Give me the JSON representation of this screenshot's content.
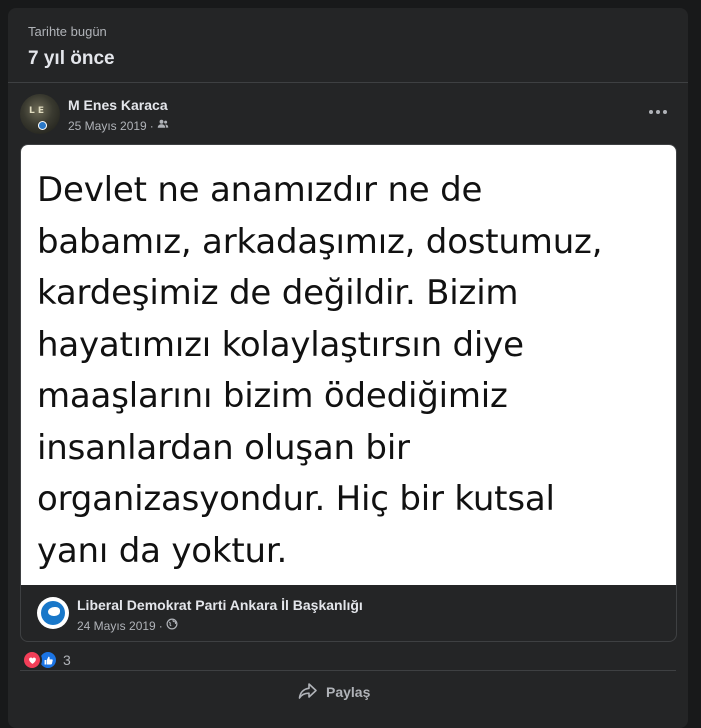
{
  "memory": {
    "subtitle": "Tarihte bugün",
    "title": "7 yıl önce"
  },
  "post": {
    "author": "M Enes Karaca",
    "date": "25 Mayıs 2019",
    "separator": "·",
    "audience_icon": "friends-icon",
    "more_icon": "more-options-icon",
    "avatar_text": "L E"
  },
  "shared": {
    "quote": "Devlet ne anamızdır ne de\nbabamız, arkadaşımız, dostumuz,\nkardeşimiz de değildir. Bizim\nhayatımızı kolaylaştırsın diye\nmaaşlarını bizim ödediğimiz\ninsanlardan oluşan bir\norganizasyondur. Hiç bir kutsal\nyanı da yoktur.",
    "page_name": "Liberal Demokrat Parti Ankara İl Başkanlığı",
    "date": "24 Mayıs 2019",
    "separator": "·",
    "audience_icon": "globe-icon"
  },
  "reactions": {
    "count": "3",
    "types": [
      "love",
      "like"
    ],
    "love_color": "#f33e58",
    "like_color": "#1b74e4"
  },
  "actions": {
    "share_label": "Paylaş",
    "share_icon": "share-arrow-icon"
  },
  "colors": {
    "background": "#18191a",
    "card": "#242526",
    "primary_text": "#e4e6eb",
    "secondary_text": "#b0b3b8",
    "divider": "#3e4042"
  }
}
